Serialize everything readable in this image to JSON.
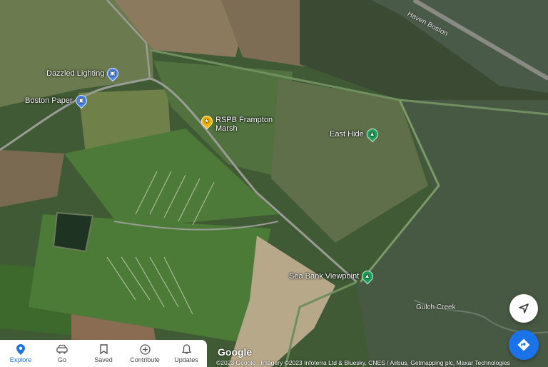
{
  "map": {
    "places": [
      {
        "name": "Dazzled Lighting",
        "icon": "shopping-bag-icon",
        "color": "#4a8af4"
      },
      {
        "name": "Boston Paper",
        "icon": "shopping-bag-icon",
        "color": "#4a8af4"
      },
      {
        "name": "RSPB Frampton",
        "name2": "Marsh",
        "icon": "park-pin-icon",
        "color": "#f4b400"
      },
      {
        "name": "East Hide",
        "icon": "tree-pin-icon",
        "color": "#1e9e5a"
      },
      {
        "name": "Sea Bank Viewpoint",
        "icon": "tree-pin-icon",
        "color": "#1e9e5a"
      }
    ],
    "road_label": "Haven Boston",
    "water_label": "Gulch Creek",
    "logo": "Google",
    "attribution": "©2023 Google · Imagery ©2023 Infoterra Ltd & Bluesky, CNES / Airbus, Getmapping plc, Maxar Technologies"
  },
  "controls": {
    "location_icon": "navigation-arrow-icon",
    "directions_icon": "directions-icon",
    "directions_color": "#1a73e8"
  },
  "nav": {
    "items": [
      {
        "label": "Explore",
        "icon": "location-pin-icon",
        "active": true
      },
      {
        "label": "Go",
        "icon": "car-icon",
        "active": false
      },
      {
        "label": "Saved",
        "icon": "bookmark-icon",
        "active": false
      },
      {
        "label": "Contribute",
        "icon": "plus-circle-icon",
        "active": false
      },
      {
        "label": "Updates",
        "icon": "bell-icon",
        "active": false
      }
    ]
  }
}
